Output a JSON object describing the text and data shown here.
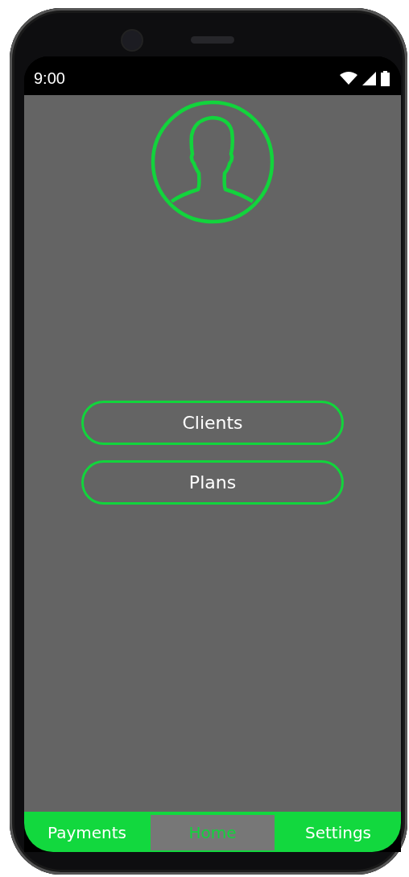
{
  "status_bar": {
    "time": "9:00"
  },
  "buttons": [
    "Clients",
    "Plans"
  ],
  "bottom_nav": [
    {
      "label": "Payments",
      "selected": false
    },
    {
      "label": "Home",
      "selected": true
    },
    {
      "label": "Settings",
      "selected": false
    }
  ]
}
